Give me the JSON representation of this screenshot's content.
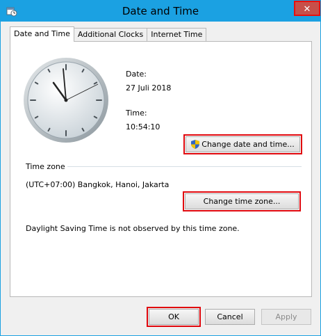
{
  "window": {
    "title": "Date and Time",
    "close_glyph": "✕"
  },
  "tabs": [
    {
      "label": "Date and Time",
      "active": true
    },
    {
      "label": "Additional Clocks",
      "active": false
    },
    {
      "label": "Internet Time",
      "active": false
    }
  ],
  "date_section": {
    "date_label": "Date:",
    "date_value": "27 Juli 2018",
    "time_label": "Time:",
    "time_value": "10:54:10",
    "change_button": "Change date and time..."
  },
  "timezone_section": {
    "header": "Time zone",
    "value": "(UTC+07:00) Bangkok, Hanoi, Jakarta",
    "change_button": "Change time zone...",
    "dst_note": "Daylight Saving Time is not observed by this time zone."
  },
  "footer": {
    "ok": "OK",
    "cancel": "Cancel",
    "apply": "Apply"
  },
  "icons": {
    "app": "date-time-icon",
    "shield": "uac-shield-icon",
    "clock": "analog-clock"
  },
  "colors": {
    "titlebar": "#1ba1e2",
    "highlight": "#e0070d",
    "close": "#c7504a"
  }
}
